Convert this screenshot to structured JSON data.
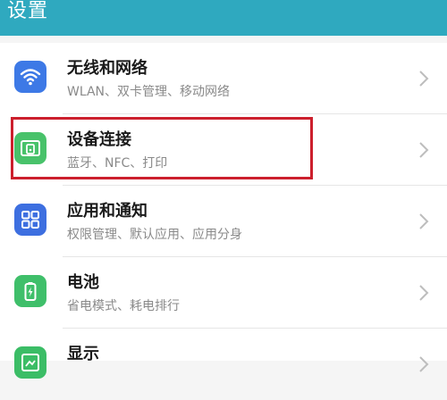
{
  "header": {
    "title": "设置"
  },
  "colors": {
    "header": "#2fa9bf",
    "highlight": "#cc1f2d",
    "wifi_icon": "#3d79e6",
    "device_icon": "#48c26a",
    "apps_icon": "#3d6fe0",
    "battery_icon": "#3fbf6a",
    "display_icon": "#3bbd66"
  },
  "settings": {
    "items": [
      {
        "title": "无线和网络",
        "subtitle": "WLAN、双卡管理、移动网络",
        "icon": "wifi-icon"
      },
      {
        "title": "设备连接",
        "subtitle": "蓝牙、NFC、打印",
        "icon": "device-connection-icon",
        "highlighted": true
      },
      {
        "title": "应用和通知",
        "subtitle": "权限管理、默认应用、应用分身",
        "icon": "apps-icon"
      },
      {
        "title": "电池",
        "subtitle": "省电模式、耗电排行",
        "icon": "battery-icon"
      },
      {
        "title": "显示",
        "subtitle": "",
        "icon": "display-icon"
      }
    ]
  }
}
